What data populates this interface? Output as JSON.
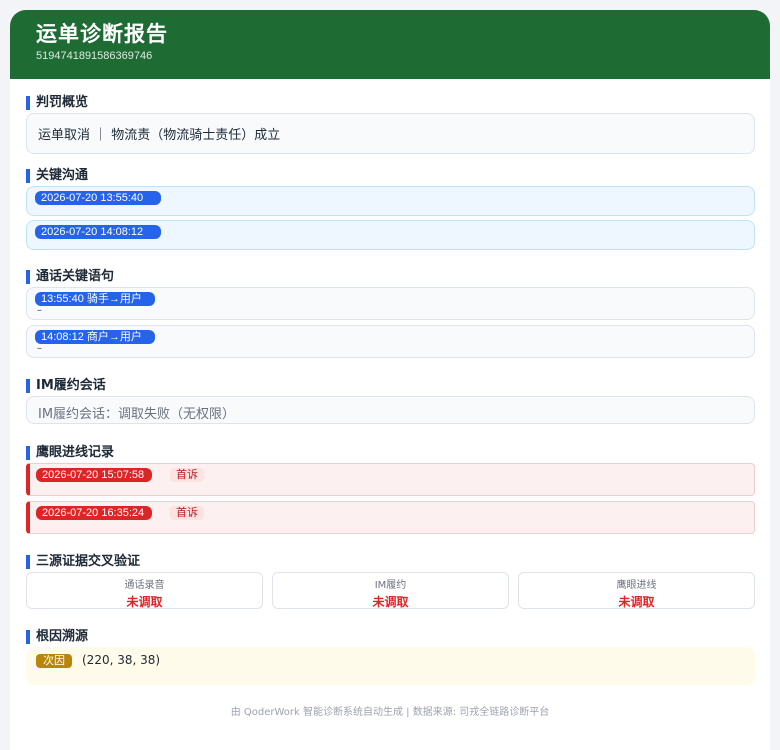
{
  "header": {
    "title": "运单诊断报告",
    "order_id": "5194741891586369746"
  },
  "penalty": {
    "title": "判罚概览",
    "text": "运单取消 ｜ 物流责（物流骑士责任）成立"
  },
  "communication": {
    "title": "关键沟通",
    "items": [
      {
        "time": "2026-07-20 13:55:40"
      },
      {
        "time": "2026-07-20 14:08:12"
      }
    ]
  },
  "call_quotes": {
    "title": "通话关键语句",
    "items": [
      {
        "label": "13:55:40  骑手→用户",
        "text": "–"
      },
      {
        "label": "14:08:12  商户→用户",
        "text": "–"
      }
    ]
  },
  "im": {
    "title": "IM履约会话",
    "text": "IM履约会话：调取失败（无权限）"
  },
  "hawkeye": {
    "title": "鹰眼进线记录",
    "items": [
      {
        "time": "2026-07-20 15:07:58",
        "tag": "首诉"
      },
      {
        "time": "2026-07-20 16:35:24",
        "tag": "首诉"
      }
    ]
  },
  "cross_check": {
    "title": "三源证据交叉验证",
    "sources": [
      {
        "label": "通话录音",
        "status": "未调取"
      },
      {
        "label": "IM履约",
        "status": "未调取"
      },
      {
        "label": "鹰眼进线",
        "status": "未调取"
      }
    ]
  },
  "root_cause": {
    "title": "根因溯源",
    "badge": "次因",
    "text": "(220, 38, 38)"
  },
  "footer": {
    "text": "由 QoderWork 智能诊断系统自动生成 | 数据来源: 司戎全链路诊断平台"
  },
  "colors": {
    "header_bg": "#1e6b34",
    "accent_blue": "#2563eb",
    "alert_red": "#dc2626",
    "badge_gold": "#b8860b"
  }
}
